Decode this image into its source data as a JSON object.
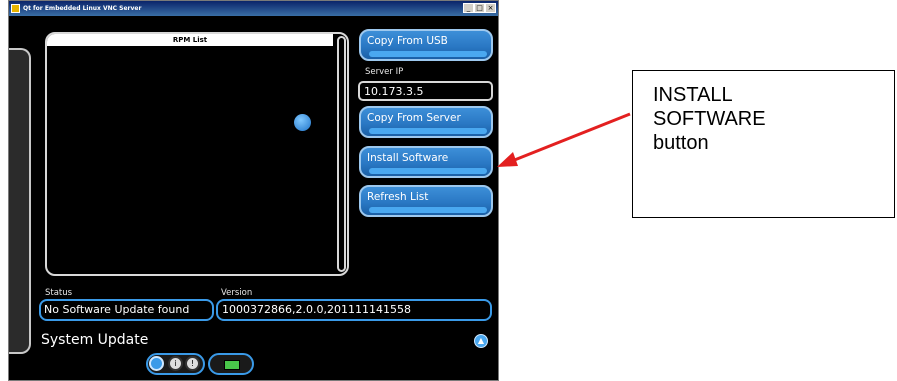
{
  "window": {
    "title": "Qt for Embedded Linux VNC Server",
    "controls": [
      "_",
      "□",
      "×"
    ]
  },
  "rpm_list": {
    "header": "RPM List",
    "items": []
  },
  "buttons": {
    "copy_usb": "Copy From USB",
    "copy_server": "Copy From Server",
    "install": "Install Software",
    "refresh": "Refresh List"
  },
  "server_ip": {
    "label": "Server IP",
    "value": "10.173.3.5"
  },
  "status": {
    "label": "Status",
    "value": "No Software Update found"
  },
  "version": {
    "label": "Version",
    "value": "1000372866,2.0.0,201111141558"
  },
  "footer": {
    "title": "System Update"
  },
  "annotation": {
    "line1": "INSTALL",
    "line2": "SOFTWARE",
    "line3": "button"
  },
  "colors": {
    "accent": "#2a78c4",
    "arrow": "#e32020"
  }
}
